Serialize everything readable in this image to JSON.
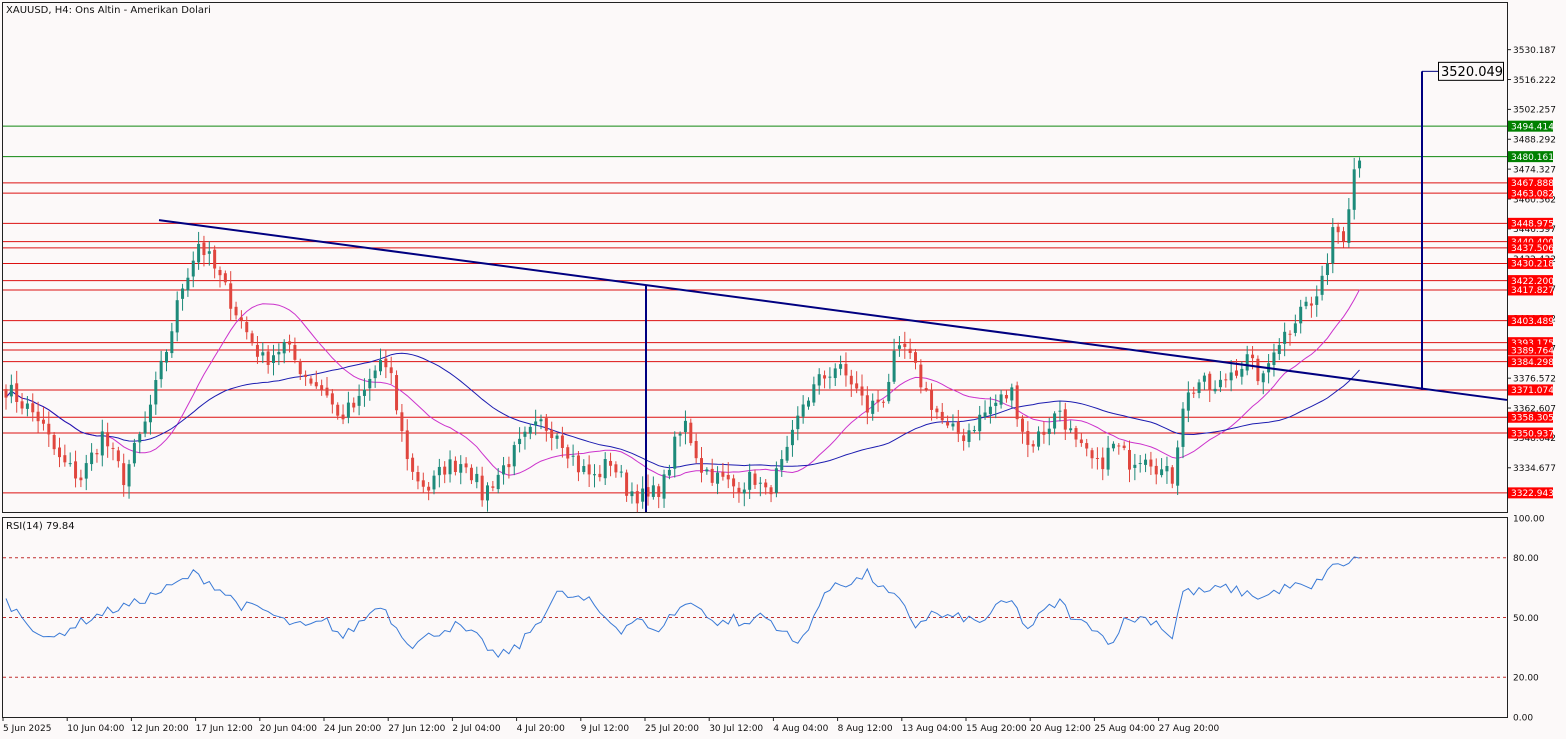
{
  "header": {
    "title": "XAUUSD, H4:  Ons Altin - Amerikan Dolari"
  },
  "rsi_header": "RSI(14) 79.84",
  "colors": {
    "background": "#fcf9f9",
    "bull": "#1d8a7a",
    "bear": "#e0463e",
    "support_line": "#dd1111",
    "green_line": "#118811",
    "trendline": "#000080",
    "ma_fast": "#cc33cc",
    "ma_slow": "#1c1cb0",
    "rsi": "#3a7ad6",
    "tag_red": "#ff0000",
    "tag_green": "#008000"
  },
  "chart_data": [
    {
      "type": "candlestick",
      "symbol": "XAUUSD",
      "timeframe": "H4",
      "ylim": [
        3314.0,
        3552.0
      ],
      "y_ticks": [
        3530.187,
        3516.222,
        3502.257,
        3488.292,
        3474.327,
        3460.362,
        3446.397,
        3432.432,
        3418.467,
        3404.502,
        3390.537,
        3376.572,
        3362.607,
        3348.642,
        3334.677
      ],
      "x_labels": [
        "5 Jun 2025",
        "10 Jun 04:00",
        "12 Jun 20:00",
        "17 Jun 12:00",
        "20 Jun 04:00",
        "24 Jun 20:00",
        "27 Jun 12:00",
        "2 Jul 04:00",
        "4 Jul 20:00",
        "9 Jul 12:00",
        "25 Jul 20:00",
        "30 Jul 12:00",
        "4 Aug 04:00",
        "8 Aug 12:00",
        "13 Aug 04:00",
        "15 Aug 20:00",
        "20 Aug 12:00",
        "25 Aug 04:00",
        "27 Aug 20:00"
      ],
      "close_anchors": [
        [
          0,
          3372
        ],
        [
          6,
          3358
        ],
        [
          10,
          3338
        ],
        [
          14,
          3330
        ],
        [
          18,
          3350
        ],
        [
          22,
          3330
        ],
        [
          26,
          3355
        ],
        [
          28,
          3372
        ],
        [
          30,
          3390
        ],
        [
          33,
          3420
        ],
        [
          36,
          3440
        ],
        [
          38,
          3432
        ],
        [
          41,
          3418
        ],
        [
          45,
          3398
        ],
        [
          48,
          3385
        ],
        [
          52,
          3392
        ],
        [
          56,
          3378
        ],
        [
          60,
          3370
        ],
        [
          62,
          3358
        ],
        [
          66,
          3365
        ],
        [
          70,
          3385
        ],
        [
          72,
          3375
        ],
        [
          74,
          3350
        ],
        [
          76,
          3332
        ],
        [
          79,
          3325
        ],
        [
          82,
          3335
        ],
        [
          86,
          3338
        ],
        [
          89,
          3322
        ],
        [
          93,
          3335
        ],
        [
          97,
          3348
        ],
        [
          100,
          3355
        ],
        [
          103,
          3352
        ],
        [
          107,
          3335
        ],
        [
          110,
          3330
        ],
        [
          113,
          3338
        ],
        [
          116,
          3325
        ],
        [
          120,
          3320
        ],
        [
          123,
          3328
        ],
        [
          125,
          3345
        ],
        [
          127,
          3355
        ],
        [
          130,
          3335
        ],
        [
          133,
          3330
        ],
        [
          136,
          3326
        ],
        [
          140,
          3330
        ],
        [
          142,
          3322
        ],
        [
          146,
          3340
        ],
        [
          149,
          3365
        ],
        [
          152,
          3375
        ],
        [
          155,
          3382
        ],
        [
          158,
          3375
        ],
        [
          161,
          3362
        ],
        [
          164,
          3368
        ],
        [
          166,
          3385
        ],
        [
          168,
          3390
        ],
        [
          170,
          3380
        ],
        [
          173,
          3365
        ],
        [
          176,
          3352
        ],
        [
          179,
          3350
        ],
        [
          182,
          3358
        ],
        [
          185,
          3365
        ],
        [
          188,
          3370
        ],
        [
          191,
          3345
        ],
        [
          194,
          3352
        ],
        [
          197,
          3362
        ],
        [
          200,
          3345
        ],
        [
          204,
          3335
        ],
        [
          207,
          3345
        ],
        [
          210,
          3338
        ],
        [
          213,
          3342
        ],
        [
          216,
          3333
        ],
        [
          218,
          3330
        ],
        [
          220,
          3365
        ],
        [
          223,
          3375
        ],
        [
          226,
          3370
        ],
        [
          229,
          3380
        ],
        [
          232,
          3385
        ],
        [
          235,
          3375
        ],
        [
          237,
          3392
        ],
        [
          240,
          3400
        ],
        [
          242,
          3412
        ],
        [
          244,
          3410
        ],
        [
          246,
          3420
        ],
        [
          248,
          3448
        ],
        [
          250,
          3445
        ],
        [
          252,
          3475
        ],
        [
          253,
          3482
        ]
      ],
      "rsi_anchors": [
        [
          0,
          58
        ],
        [
          4,
          48
        ],
        [
          8,
          38
        ],
        [
          12,
          45
        ],
        [
          16,
          50
        ],
        [
          20,
          54
        ],
        [
          24,
          57
        ],
        [
          28,
          62
        ],
        [
          32,
          67
        ],
        [
          35,
          72
        ],
        [
          38,
          68
        ],
        [
          41,
          62
        ],
        [
          44,
          56
        ],
        [
          48,
          54
        ],
        [
          52,
          48
        ],
        [
          56,
          45
        ],
        [
          60,
          48
        ],
        [
          63,
          40
        ],
        [
          66,
          47
        ],
        [
          70,
          57
        ],
        [
          73,
          45
        ],
        [
          76,
          36
        ],
        [
          80,
          42
        ],
        [
          84,
          46
        ],
        [
          88,
          40
        ],
        [
          92,
          30
        ],
        [
          96,
          36
        ],
        [
          100,
          50
        ],
        [
          103,
          62
        ],
        [
          106,
          60
        ],
        [
          109,
          58
        ],
        [
          112,
          50
        ],
        [
          115,
          44
        ],
        [
          118,
          50
        ],
        [
          121,
          42
        ],
        [
          124,
          50
        ],
        [
          127,
          57
        ],
        [
          130,
          55
        ],
        [
          133,
          46
        ],
        [
          136,
          50
        ],
        [
          138,
          45
        ],
        [
          141,
          52
        ],
        [
          144,
          46
        ],
        [
          148,
          36
        ],
        [
          152,
          56
        ],
        [
          155,
          68
        ],
        [
          158,
          67
        ],
        [
          161,
          72
        ],
        [
          164,
          64
        ],
        [
          167,
          58
        ],
        [
          170,
          46
        ],
        [
          173,
          52
        ],
        [
          176,
          50
        ],
        [
          179,
          50
        ],
        [
          182,
          47
        ],
        [
          185,
          55
        ],
        [
          188,
          58
        ],
        [
          191,
          44
        ],
        [
          194,
          53
        ],
        [
          197,
          58
        ],
        [
          200,
          48
        ],
        [
          204,
          45
        ],
        [
          206,
          36
        ],
        [
          209,
          48
        ],
        [
          212,
          50
        ],
        [
          215,
          48
        ],
        [
          218,
          40
        ],
        [
          220,
          63
        ],
        [
          224,
          63
        ],
        [
          228,
          65
        ],
        [
          232,
          62
        ],
        [
          235,
          60
        ],
        [
          238,
          64
        ],
        [
          241,
          66
        ],
        [
          244,
          64
        ],
        [
          247,
          74
        ],
        [
          250,
          77
        ],
        [
          253,
          79.84
        ]
      ],
      "levels": [
        {
          "value": 3494.414,
          "label": "3494.414",
          "color": "green"
        },
        {
          "value": 3480.161,
          "label": "3480.161",
          "color": "green"
        },
        {
          "value": 3467.888,
          "label": "3467.888",
          "color": "red"
        },
        {
          "value": 3463.082,
          "label": "3463.082",
          "color": "red"
        },
        {
          "value": 3448.975,
          "label": "3448.975",
          "color": "red"
        },
        {
          "value": 3440.4,
          "label": "3440.400",
          "color": "red"
        },
        {
          "value": 3437.506,
          "label": "3437.506",
          "color": "red"
        },
        {
          "value": 3430.218,
          "label": "3430.218",
          "color": "red"
        },
        {
          "value": 3422.2,
          "label": "3422.200",
          "color": "red"
        },
        {
          "value": 3417.827,
          "label": "3417.827",
          "color": "red"
        },
        {
          "value": 3403.489,
          "label": "3403.489",
          "color": "red"
        },
        {
          "value": 3393.175,
          "label": "3393.175",
          "color": "red"
        },
        {
          "value": 3389.764,
          "label": "3389.764",
          "color": "red"
        },
        {
          "value": 3384.298,
          "label": "3384.298",
          "color": "red"
        },
        {
          "value": 3371.074,
          "label": "3371.074",
          "color": "red"
        },
        {
          "value": 3358.305,
          "label": "3358.305",
          "color": "red"
        },
        {
          "value": 3350.937,
          "label": "3350.937",
          "color": "red"
        },
        {
          "value": 3322.943,
          "label": "3322.943",
          "color": "red"
        }
      ],
      "target_label": "3520.049",
      "rsi": {
        "period": 14,
        "current": 79.84,
        "ylim": [
          0,
          100
        ],
        "levels": [
          80,
          50,
          20
        ],
        "tick_labels": [
          "100.00",
          "80.00",
          "50.00",
          "20.00",
          "0.00"
        ]
      }
    }
  ]
}
